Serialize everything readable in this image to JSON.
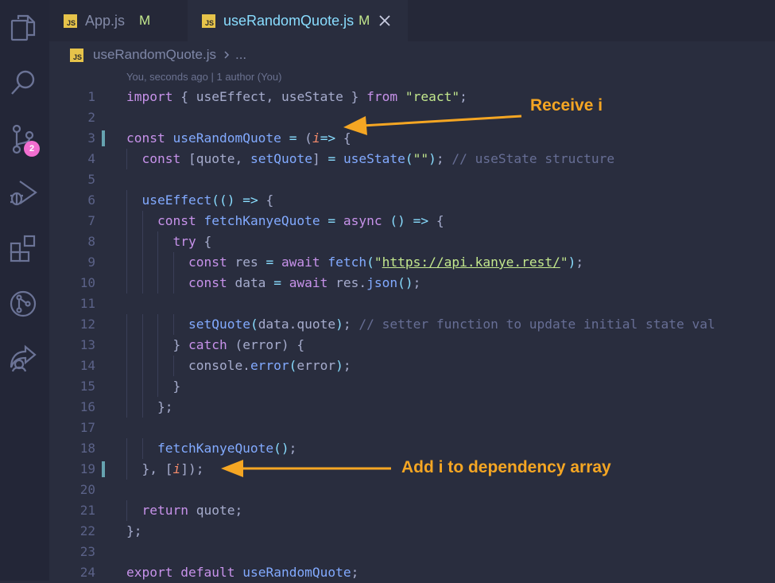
{
  "tabs": [
    {
      "label": "App.js",
      "badge": "JS",
      "modified": "M",
      "active": false
    },
    {
      "label": "useRandomQuote.js",
      "badge": "JS",
      "modified": "M",
      "active": true
    }
  ],
  "breadcrumb": {
    "file": "useRandomQuote.js",
    "trail": "...",
    "badge": "JS"
  },
  "blame": "You, seconds ago | 1 author (You)",
  "activity_bar": {
    "icons": [
      "files-icon",
      "search-icon",
      "source-control-icon",
      "run-debug-icon",
      "extensions-icon",
      "git-graph-icon",
      "live-share-icon"
    ],
    "scm_badge": "2"
  },
  "annotations": {
    "receive": "Receive i",
    "dependency": "Add i to dependency array"
  },
  "colors": {
    "accent": "#f5a623",
    "badge": "#f26ed0",
    "background": "#292d3e"
  },
  "code": [
    {
      "n": "1",
      "segs": [
        [
          "kw",
          "import"
        ],
        [
          "",
          "{ "
        ],
        [
          "prop",
          "useEffect"
        ],
        [
          "",
          ", "
        ],
        [
          "prop",
          "useState"
        ],
        [
          "",
          " } "
        ],
        [
          "kw",
          "from"
        ],
        [
          "",
          " "
        ],
        [
          "str",
          "\"react\""
        ],
        [
          "",
          ";"
        ]
      ]
    },
    {
      "n": "2",
      "segs": []
    },
    {
      "n": "3",
      "segs": [
        [
          "kw",
          "const"
        ],
        [
          "",
          " "
        ],
        [
          "fn",
          "useRandomQuote"
        ],
        [
          "",
          " "
        ],
        [
          "op",
          "="
        ],
        [
          "",
          " ("
        ],
        [
          "param",
          "i"
        ],
        [
          ") "
        ],
        [
          "op",
          "=>"
        ],
        [
          "",
          " {"
        ]
      ]
    },
    {
      "n": "4",
      "segs": [
        [
          "",
          "  "
        ],
        [
          "kw",
          "const"
        ],
        [
          "",
          " ["
        ],
        [
          "prop",
          "quote"
        ],
        [
          "",
          ", "
        ],
        [
          "fn",
          "setQuote"
        ],
        [
          "",
          "] "
        ],
        [
          "op",
          "="
        ],
        [
          "",
          " "
        ],
        [
          "fn",
          "useState"
        ],
        [
          "op",
          "("
        ],
        [
          "str",
          "\"\""
        ],
        [
          "op",
          ")"
        ],
        [
          "",
          "; "
        ],
        [
          "cmt",
          "// useState structure"
        ]
      ]
    },
    {
      "n": "5",
      "segs": []
    },
    {
      "n": "6",
      "segs": [
        [
          "",
          "  "
        ],
        [
          "fn",
          "useEffect"
        ],
        [
          "op",
          "(() =>"
        ],
        [
          "",
          " {"
        ]
      ]
    },
    {
      "n": "7",
      "segs": [
        [
          "",
          "    "
        ],
        [
          "kw",
          "const"
        ],
        [
          "",
          " "
        ],
        [
          "fn",
          "fetchKanyeQuote"
        ],
        [
          "",
          " "
        ],
        [
          "op",
          "="
        ],
        [
          "",
          " "
        ],
        [
          "kw",
          "async"
        ],
        [
          "",
          " "
        ],
        [
          "op",
          "() =>"
        ],
        [
          "",
          " {"
        ]
      ]
    },
    {
      "n": "8",
      "segs": [
        [
          "",
          "      "
        ],
        [
          "kw",
          "try"
        ],
        [
          "",
          " {"
        ]
      ]
    },
    {
      "n": "9",
      "segs": [
        [
          "",
          "        "
        ],
        [
          "kw",
          "const"
        ],
        [
          "",
          " res "
        ],
        [
          "op",
          "="
        ],
        [
          "",
          " "
        ],
        [
          "kw",
          "await"
        ],
        [
          "",
          " "
        ],
        [
          "fn",
          "fetch"
        ],
        [
          "op",
          "("
        ],
        [
          "str",
          "\""
        ],
        [
          "url",
          "https://api.kanye.rest/"
        ],
        [
          "str",
          "\""
        ],
        [
          "op",
          ")"
        ],
        [
          "",
          ";"
        ]
      ]
    },
    {
      "n": "10",
      "segs": [
        [
          "",
          "        "
        ],
        [
          "kw",
          "const"
        ],
        [
          "",
          " data "
        ],
        [
          "op",
          "="
        ],
        [
          "",
          " "
        ],
        [
          "kw",
          "await"
        ],
        [
          "",
          " res."
        ],
        [
          "fn",
          "json"
        ],
        [
          "op",
          "()"
        ],
        [
          "",
          ";"
        ]
      ]
    },
    {
      "n": "11",
      "segs": []
    },
    {
      "n": "12",
      "segs": [
        [
          "",
          "        "
        ],
        [
          "fn",
          "setQuote"
        ],
        [
          "op",
          "("
        ],
        [
          "",
          "data.quote"
        ],
        [
          "op",
          ")"
        ],
        [
          "",
          "; "
        ],
        [
          "cmt",
          "// setter function to update initial state val"
        ]
      ]
    },
    {
      "n": "13",
      "segs": [
        [
          "",
          "      } "
        ],
        [
          "kw",
          "catch"
        ],
        [
          "",
          " (error) {"
        ]
      ]
    },
    {
      "n": "14",
      "segs": [
        [
          "",
          "        console."
        ],
        [
          "fn",
          "error"
        ],
        [
          "op",
          "("
        ],
        [
          "",
          "error"
        ],
        [
          "op",
          ")"
        ],
        [
          "",
          ";"
        ]
      ]
    },
    {
      "n": "15",
      "segs": [
        [
          "",
          "      }"
        ]
      ]
    },
    {
      "n": "16",
      "segs": [
        [
          "",
          "    };"
        ]
      ]
    },
    {
      "n": "17",
      "segs": []
    },
    {
      "n": "18",
      "segs": [
        [
          "",
          "    "
        ],
        [
          "fn",
          "fetchKanyeQuote"
        ],
        [
          "op",
          "()"
        ],
        [
          "",
          ";"
        ]
      ]
    },
    {
      "n": "19",
      "segs": [
        [
          "",
          "  }, ["
        ],
        [
          "param",
          "i"
        ],
        [
          "",
          "]);"
        ]
      ]
    },
    {
      "n": "20",
      "segs": []
    },
    {
      "n": "21",
      "segs": [
        [
          "",
          "  "
        ],
        [
          "kw",
          "return"
        ],
        [
          "",
          " quote;"
        ]
      ]
    },
    {
      "n": "22",
      "segs": [
        [
          "",
          "};"
        ]
      ]
    },
    {
      "n": "23",
      "segs": []
    },
    {
      "n": "24",
      "segs": [
        [
          "kw",
          "export"
        ],
        [
          "",
          " "
        ],
        [
          "kw",
          "default"
        ],
        [
          "",
          " "
        ],
        [
          "fn",
          "useRandomQuote"
        ],
        [
          "",
          ";"
        ]
      ]
    }
  ]
}
